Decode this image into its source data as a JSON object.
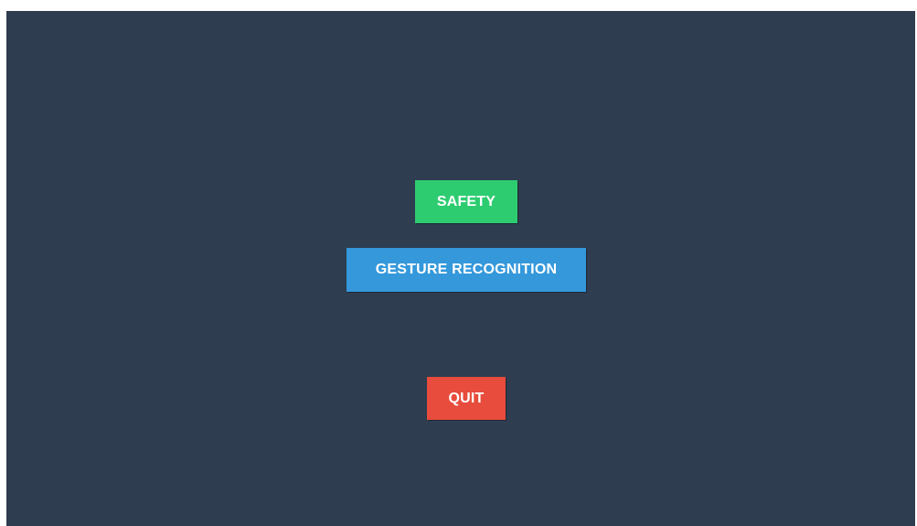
{
  "menu": {
    "background_color": "#2e3d50",
    "buttons": [
      {
        "id": "safety",
        "label": "SAFETY",
        "color": "#2ecc71"
      },
      {
        "id": "gesture",
        "label": "GESTURE RECOGNITION",
        "color": "#3498db"
      },
      {
        "id": "quit",
        "label": "QUIT",
        "color": "#e74c3c"
      }
    ]
  }
}
